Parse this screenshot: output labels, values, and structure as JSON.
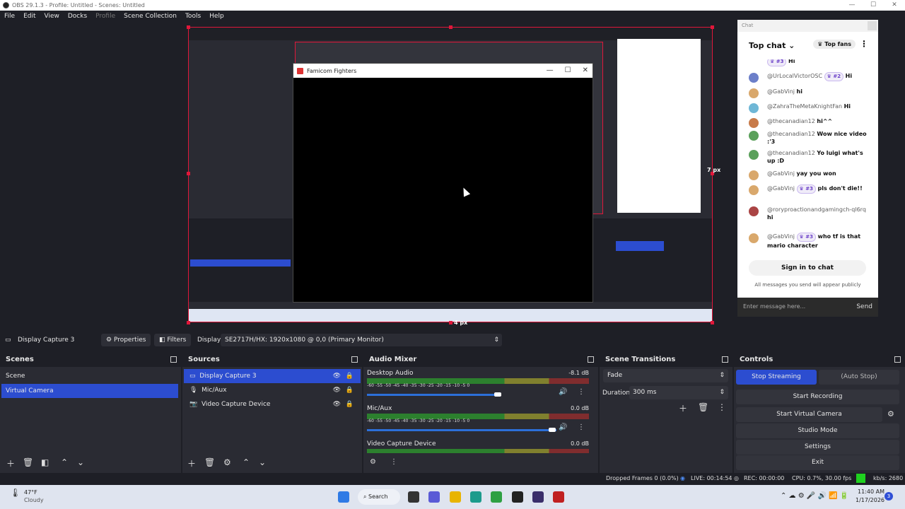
{
  "window": {
    "title": "OBS 29.1.3 - Profile: Untitled - Scenes: Untitled"
  },
  "menu": [
    "File",
    "Edit",
    "View",
    "Docks",
    "Profile",
    "Scene Collection",
    "Tools",
    "Help"
  ],
  "preview": {
    "game_window_title": "Famicom Fighters",
    "px_right": "7 px",
    "px_bottom": "4 px"
  },
  "chat": {
    "header": "Chat",
    "mode": "Top chat",
    "top_fans": "Top fans",
    "messages": [
      {
        "author": "",
        "badge": "#3",
        "text": "Hi"
      },
      {
        "author": "@UrLocalVictorOSC",
        "badge": "#2",
        "text": "Hi"
      },
      {
        "author": "@GabVinj",
        "badge": "",
        "text": "hi"
      },
      {
        "author": "@ZahraTheMetaKnightFan",
        "badge": "",
        "text": "Hi"
      },
      {
        "author": "@thecanadian12",
        "badge": "",
        "text": "hi^^"
      },
      {
        "author": "@thecanadian12",
        "badge": "",
        "text": "Wow nice video :'3"
      },
      {
        "author": "@thecanadian12",
        "badge": "",
        "text": "Yo luigi what's up :D"
      },
      {
        "author": "@GabVinj",
        "badge": "",
        "text": "yay you won"
      },
      {
        "author": "@GabVinj",
        "badge": "#3",
        "text": "pls don't die!!"
      },
      {
        "author": "@roryproactionandgamingch-ql6rq",
        "badge": "",
        "text": "hi"
      },
      {
        "author": "@GabVinj",
        "badge": "#3",
        "text": "who tf is that mario character"
      }
    ],
    "sign_in": "Sign in to chat",
    "public_note": "All messages you send will appear publicly",
    "input_placeholder": "Enter message here...",
    "send": "Send"
  },
  "source_toolbar": {
    "source_name": "Display Capture 3",
    "properties": "Properties",
    "filters": "Filters",
    "display_label": "Display",
    "display_value": "SE2717H/HX: 1920x1080 @ 0,0 (Primary Monitor)"
  },
  "scenes": {
    "title": "Scenes",
    "items": [
      "Scene",
      "Virtual Camera"
    ],
    "selected": "Virtual Camera"
  },
  "sources": {
    "title": "Sources",
    "items": [
      "Display Capture 3",
      "Mic/Aux",
      "Video Capture Device"
    ]
  },
  "audio_mixer": {
    "title": "Audio Mixer",
    "channels": [
      {
        "name": "Desktop Audio",
        "db": "-8.1 dB",
        "volume": 0.82
      },
      {
        "name": "Mic/Aux",
        "db": "0.0 dB",
        "volume": 1.0
      },
      {
        "name": "Video Capture Device",
        "db": "0.0 dB",
        "volume": 1.0
      }
    ],
    "scale": "-60  -55  -50  -45  -40  -35  -30  -25  -20  -15  -10  -5  0"
  },
  "transitions": {
    "title": "Scene Transitions",
    "type": "Fade",
    "duration_label": "Duration",
    "duration_value": "300 ms"
  },
  "controls": {
    "title": "Controls",
    "stop_streaming": "Stop Streaming",
    "auto_stop": "(Auto Stop)",
    "start_recording": "Start Recording",
    "start_virtual_camera": "Start Virtual Camera",
    "studio_mode": "Studio Mode",
    "settings": "Settings",
    "exit": "Exit"
  },
  "status": {
    "dropped": "Dropped Frames 0 (0.0%)",
    "live": "LIVE: 00:14:54",
    "rec": "REC: 00:00:00",
    "cpu": "CPU: 0.7%, 30.00 fps",
    "kbs": "kb/s: 2680"
  },
  "taskbar": {
    "weather_temp": "47°F",
    "weather_desc": "Cloudy",
    "search": "Search",
    "time": "11:40 AM",
    "date": "1/17/2026",
    "notif_count": "3"
  },
  "colors": {
    "accent": "#2c4dd0",
    "live": "#e0173a",
    "ok": "#1fd11f"
  }
}
